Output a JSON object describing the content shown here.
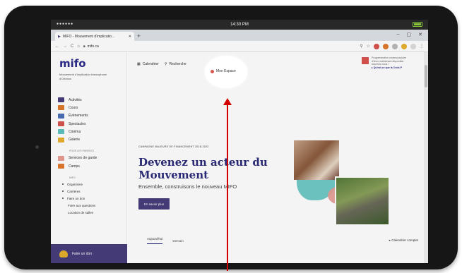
{
  "status_bar": {
    "signal": "●●●●●●",
    "time": "14:30 PM"
  },
  "browser": {
    "tab_title": "MIFO - Mouvement d'implicatio...",
    "tab_close": "✕",
    "new_tab": "+",
    "url": "mifo.ca",
    "window_controls": {
      "minimize": "–",
      "maximize": "▢",
      "close": "✕"
    }
  },
  "sidebar": {
    "logo": "mifo",
    "logo_subtitle": "Mouvement d'implication francophone d'Orléans",
    "items": [
      {
        "label": "Activités",
        "color": "#473d7c"
      },
      {
        "label": "Cours",
        "color": "#e07a2e"
      },
      {
        "label": "Événements",
        "color": "#4a6fb5"
      },
      {
        "label": "Spectacles",
        "color": "#d9534f"
      },
      {
        "label": "Cinéma",
        "color": "#5fc4c0"
      },
      {
        "label": "Galerie",
        "color": "#e6b12e"
      }
    ],
    "group_families": "POUR LES PARENTS",
    "family_items": [
      {
        "label": "Services de garde",
        "color": "#e79c93"
      },
      {
        "label": "Camps",
        "color": "#e07a2e"
      }
    ],
    "group_mifo": "MIFO",
    "mifo_items": [
      "Organisme",
      "Carrières",
      "Faire un don"
    ],
    "plain_items": [
      "Foire aux questions",
      "Location de salles"
    ],
    "donate": "Faire un don"
  },
  "header": {
    "nav": [
      "Calendrier",
      "Recherche",
      "Mon Espace"
    ],
    "promo_text": "Programmation communautaire d'hiver maintenant disponible. Inscrivez-vous !",
    "promo_link": "▸ Qu'est-ce que la Croix-P"
  },
  "hero": {
    "campaign": "CAMPAGNE MAJEURE DE FINANCEMENT 2018-2022",
    "title": "Devenez un acteur du Mouvement",
    "tagline": "Ensemble, construisons le nouveau MIFO",
    "cta": "En savoir plus"
  },
  "bottom_tabs": {
    "today": "Aujourd'hui",
    "tomorrow": "Demain",
    "calendar": "▸ Calendrier complet"
  },
  "colors": {
    "primary": "#473d7c",
    "navy": "#2b2b7a",
    "annotation": "#d40000"
  }
}
